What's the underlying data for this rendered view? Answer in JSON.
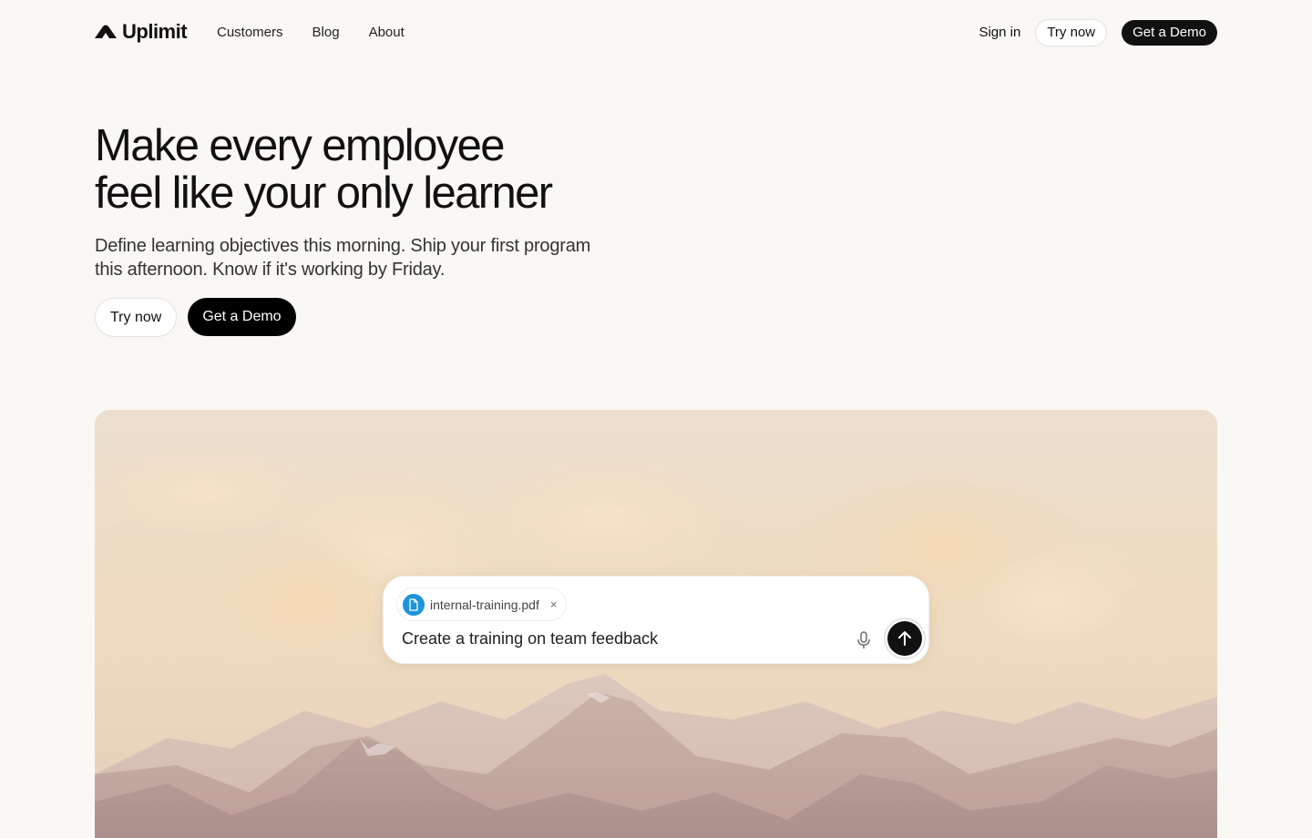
{
  "brand": {
    "name": "Uplimit"
  },
  "nav": {
    "links": [
      "Customers",
      "Blog",
      "About"
    ],
    "sign_in": "Sign in",
    "try_now": "Try now",
    "get_demo": "Get a Demo"
  },
  "hero": {
    "title_line1": "Make every employee",
    "title_line2": "feel like your only learner",
    "subtitle_line1": "Define learning objectives this morning. Ship your first program",
    "subtitle_line2": "this afternoon. Know if it's working by Friday.",
    "try_now": "Try now",
    "get_demo": "Get a Demo"
  },
  "prompt": {
    "attachment_name": "internal-training.pdf",
    "attachment_remove": "×",
    "text": "Create a training on team feedback"
  },
  "colors": {
    "background": "#f9f8f5",
    "dark_button": "#111111",
    "file_badge": "#1d95d8"
  },
  "icons": {
    "logo": "mountain-logo-icon",
    "attachment": "file-icon",
    "remove": "close-icon",
    "voice": "microphone-icon",
    "send": "arrow-up-icon"
  }
}
